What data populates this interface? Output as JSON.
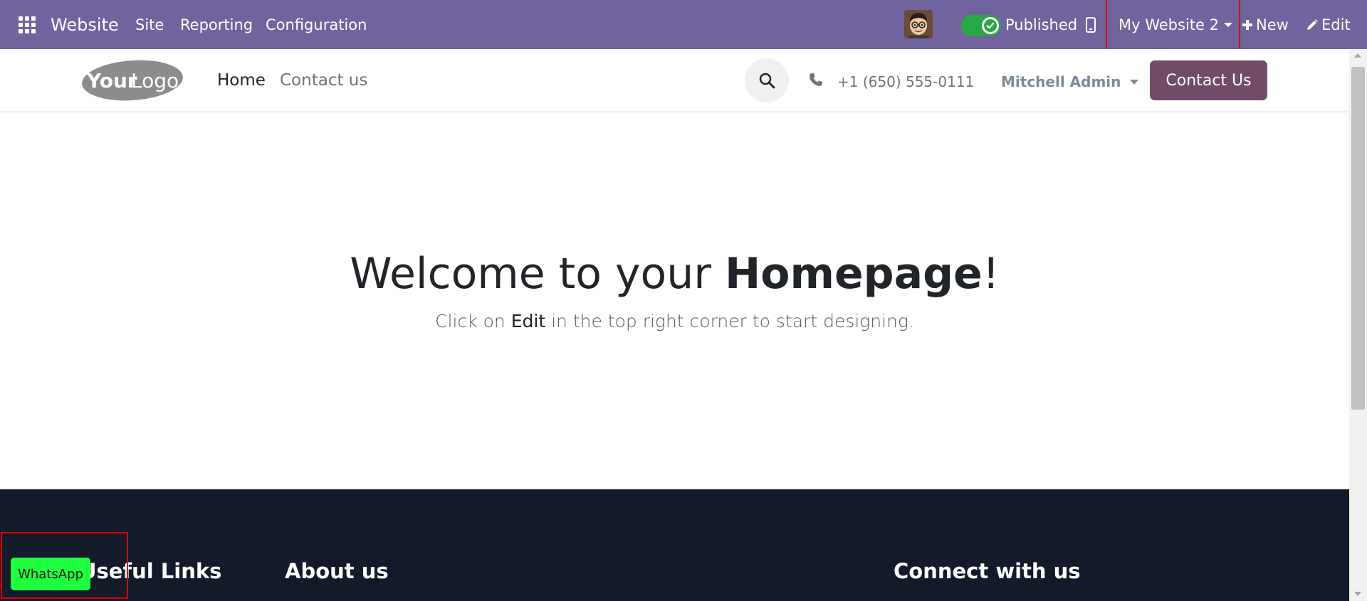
{
  "topbar": {
    "brand": "Website",
    "menu": [
      "Site",
      "Reporting",
      "Configuration"
    ],
    "published_label": "Published",
    "published_on": true,
    "website_switcher": "My Website 2",
    "new_label": "New",
    "edit_label": "Edit",
    "bg_color": "#71639e"
  },
  "header": {
    "logo_text_bold": "Your",
    "logo_text_light": "Logo",
    "nav": [
      "Home",
      "Contact us"
    ],
    "phone": "+1 (650) 555-0111",
    "user": "Mitchell Admin",
    "cta_label": "Contact Us",
    "cta_color": "#714b67"
  },
  "hero": {
    "title_prefix": "Welcome to your ",
    "title_bold": "Homepage",
    "title_suffix": "!",
    "sub_prefix": "Click on ",
    "sub_keyword": "Edit",
    "sub_suffix": " in the top right corner to start designing."
  },
  "footer": {
    "headings": [
      "Useful Links",
      "About us",
      "Connect with us"
    ],
    "bg_color": "#131a29"
  },
  "whatsapp": {
    "label": "WhatsApp",
    "color": "#1eff3d"
  },
  "icons": [
    "apps-grid-icon",
    "avatar",
    "check-icon",
    "mobile-icon",
    "caret-down-icon",
    "plus-icon",
    "pencil-icon",
    "search-icon",
    "phone-icon"
  ]
}
